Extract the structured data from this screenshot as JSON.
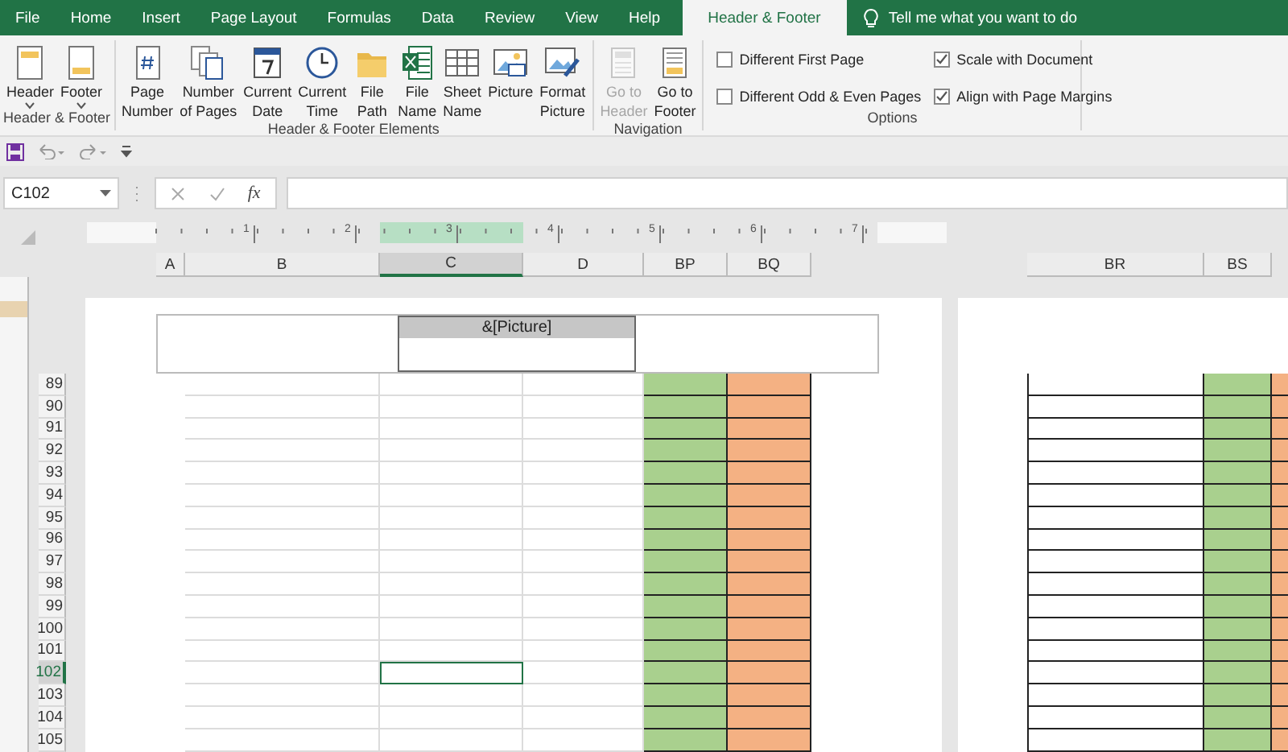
{
  "tabs": [
    {
      "label": "File",
      "selected": false
    },
    {
      "label": "Home",
      "selected": false
    },
    {
      "label": "Insert",
      "selected": false
    },
    {
      "label": "Page Layout",
      "selected": false
    },
    {
      "label": "Formulas",
      "selected": false
    },
    {
      "label": "Data",
      "selected": false
    },
    {
      "label": "Review",
      "selected": false
    },
    {
      "label": "View",
      "selected": false
    },
    {
      "label": "Help",
      "selected": false
    },
    {
      "label": "Header & Footer",
      "selected": true
    }
  ],
  "tell_me": {
    "placeholder": "Tell me what you want to do"
  },
  "ribbon": {
    "groups": [
      {
        "label": "Header & Footer",
        "buttons": [
          {
            "label": "Header",
            "dropdown": true,
            "disabled": false
          },
          {
            "label": "Footer",
            "dropdown": true,
            "disabled": false
          }
        ]
      },
      {
        "label": "Header & Footer Elements",
        "buttons": [
          {
            "label": "Page\nNumber",
            "dropdown": false,
            "disabled": false
          },
          {
            "label": "Number\nof Pages",
            "dropdown": false,
            "disabled": false
          },
          {
            "label": "Current\nDate",
            "dropdown": false,
            "disabled": false
          },
          {
            "label": "Current\nTime",
            "dropdown": false,
            "disabled": false
          },
          {
            "label": "File\nPath",
            "dropdown": false,
            "disabled": false
          },
          {
            "label": "File\nName",
            "dropdown": false,
            "disabled": false
          },
          {
            "label": "Sheet\nName",
            "dropdown": false,
            "disabled": false
          },
          {
            "label": "Picture",
            "dropdown": false,
            "disabled": false
          },
          {
            "label": "Format\nPicture",
            "dropdown": false,
            "disabled": false
          }
        ]
      },
      {
        "label": "Navigation",
        "buttons": [
          {
            "label": "Go to\nHeader",
            "dropdown": false,
            "disabled": true
          },
          {
            "label": "Go to\nFooter",
            "dropdown": false,
            "disabled": false
          }
        ]
      }
    ],
    "options": {
      "label": "Options",
      "checkboxes": [
        {
          "label": "Different First Page",
          "checked": false
        },
        {
          "label": "Different Odd & Even Pages",
          "checked": false
        },
        {
          "label": "Scale with Document",
          "checked": true
        },
        {
          "label": "Align with Page Margins",
          "checked": true
        }
      ]
    }
  },
  "formula_bar": {
    "name_box": "C102",
    "fx_label": "fx"
  },
  "ruler": {
    "labels": [
      "1",
      "2",
      "3",
      "4",
      "5",
      "6",
      "7"
    ]
  },
  "pages": [
    {
      "columns": [
        {
          "label": "A",
          "selected": false
        },
        {
          "label": "B",
          "selected": false
        },
        {
          "label": "C",
          "selected": true
        },
        {
          "label": "D",
          "selected": false
        },
        {
          "label": "BP",
          "selected": false,
          "color": "#a9d08e"
        },
        {
          "label": "BQ",
          "selected": false,
          "color": "#f4b183"
        }
      ],
      "header": {
        "center": "&[Picture]"
      }
    },
    {
      "columns": [
        {
          "label": "BR",
          "selected": false
        },
        {
          "label": "BS",
          "selected": false,
          "color": "#a9d08e"
        },
        {
          "color": "#f4b183"
        }
      ]
    }
  ],
  "rows": [
    {
      "label": "89",
      "selected": false
    },
    {
      "label": "90",
      "selected": false
    },
    {
      "label": "91",
      "selected": false
    },
    {
      "label": "92",
      "selected": false
    },
    {
      "label": "93",
      "selected": false
    },
    {
      "label": "94",
      "selected": false
    },
    {
      "label": "95",
      "selected": false
    },
    {
      "label": "96",
      "selected": false
    },
    {
      "label": "97",
      "selected": false
    },
    {
      "label": "98",
      "selected": false
    },
    {
      "label": "99",
      "selected": false
    },
    {
      "label": "100",
      "selected": false
    },
    {
      "label": "101",
      "selected": false
    },
    {
      "label": "102",
      "selected": true
    },
    {
      "label": "103",
      "selected": false
    },
    {
      "label": "104",
      "selected": false
    },
    {
      "label": "105",
      "selected": false
    }
  ]
}
